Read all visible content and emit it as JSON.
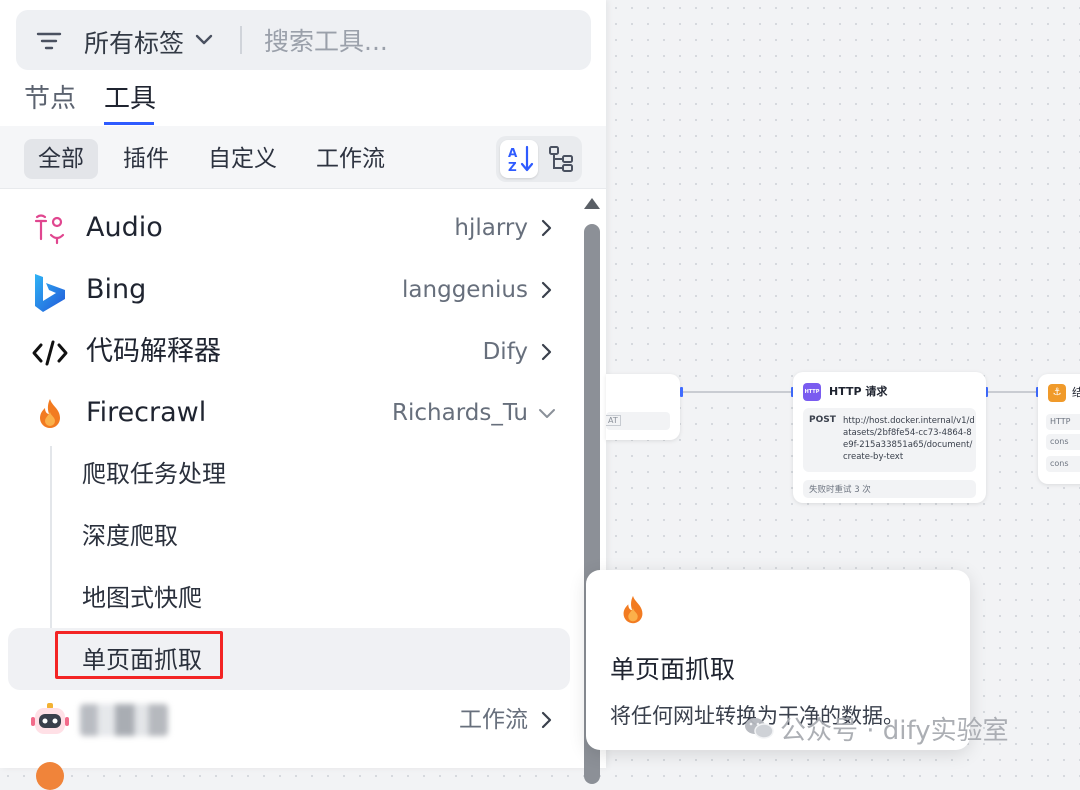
{
  "search": {
    "tag_filter_label": "所有标签",
    "placeholder": "搜索工具..."
  },
  "main_tabs": [
    {
      "label": "节点",
      "active": false
    },
    {
      "label": "工具",
      "active": true
    }
  ],
  "categories": [
    {
      "label": "全部",
      "active": true
    },
    {
      "label": "插件",
      "active": false
    },
    {
      "label": "自定义",
      "active": false
    },
    {
      "label": "工作流",
      "active": false
    }
  ],
  "tools": [
    {
      "name": "Audio",
      "author": "hjlarry",
      "icon": "audio-icon",
      "expanded": false
    },
    {
      "name": "Bing",
      "author": "langgenius",
      "icon": "bing-icon",
      "expanded": false
    },
    {
      "name": "代码解释器",
      "author": "Dify",
      "icon": "code-icon",
      "expanded": false
    },
    {
      "name": "Firecrawl",
      "author": "Richards_Tu",
      "icon": "fire-icon",
      "expanded": true,
      "actions": [
        "爬取任务处理",
        "深度爬取",
        "地图式快爬",
        "单页面抓取"
      ],
      "selected_action": "单页面抓取"
    },
    {
      "name": "",
      "author": "工作流",
      "icon": "robot-icon",
      "expanded": false
    }
  ],
  "canvas": {
    "left_node_tag": "AT",
    "http_node": {
      "icon_label": "HTTP",
      "title": "HTTP 请求",
      "method": "POST",
      "url": "http://host.docker.internal/v1/datasets/2bf8fe54-cc73-4864-8e9f-215a33851a65/document/create-by-text",
      "retry": "失败时重试 3 次"
    },
    "right_node": {
      "title": "结",
      "chips": [
        "HTTP",
        "cons",
        "cons"
      ]
    }
  },
  "tooltip": {
    "icon": "fire-icon",
    "title": "单页面抓取",
    "description": "将任何网址转换为干净的数据。"
  },
  "watermark": {
    "text": "公众号 · dify实验室",
    "icon": "wechat-icon"
  },
  "colors": {
    "accent": "#2e5bff",
    "highlight_box": "#f32424",
    "http_icon": "#7a5cf0",
    "fire": "#f27b21"
  }
}
